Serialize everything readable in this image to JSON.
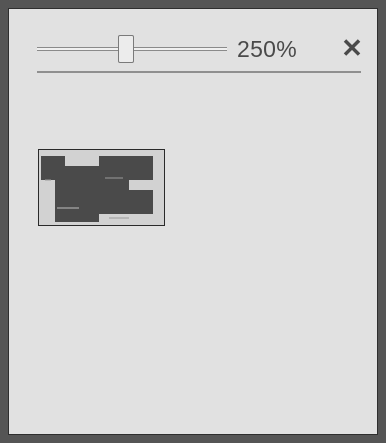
{
  "zoom": {
    "label": "250%",
    "level_fraction": 0.47
  },
  "close": {
    "glyph": "✕"
  },
  "colors": {
    "panel_bg": "#e1e1e1",
    "frame": "#555555",
    "thumbnail_dark": "#4a4a4a",
    "thumbnail_light": "#d2d2d2"
  }
}
